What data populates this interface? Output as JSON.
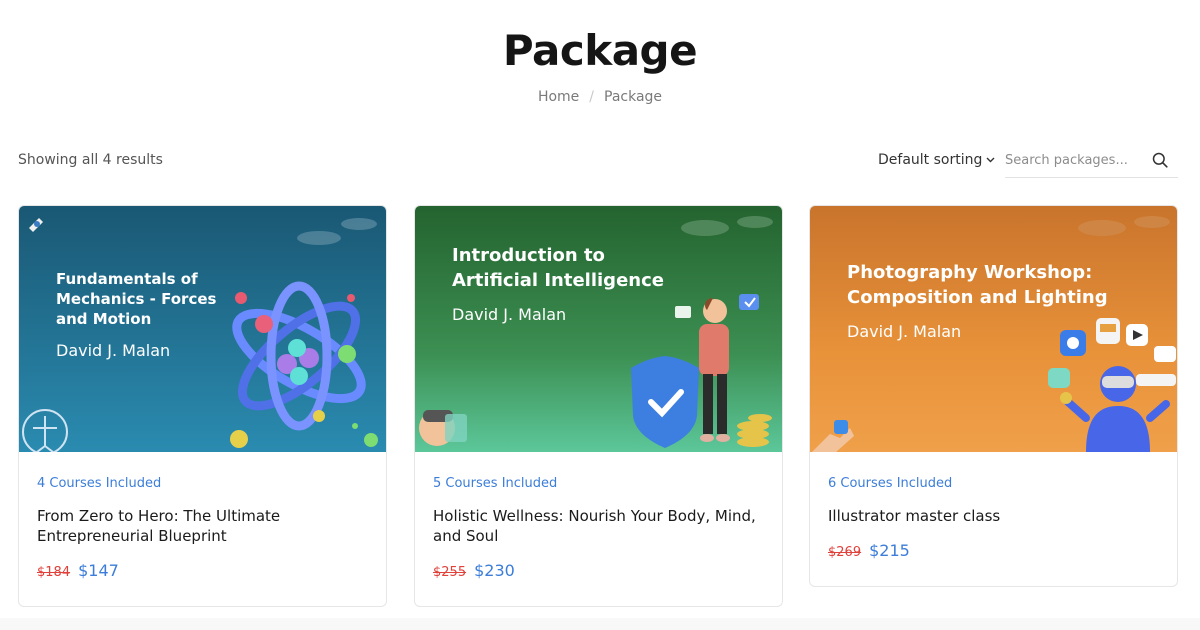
{
  "page": {
    "title": "Package",
    "breadcrumb": {
      "home": "Home",
      "separator": "/",
      "current": "Package"
    }
  },
  "toolbar": {
    "results": "Showing all 4 results",
    "sorting": "Default sorting",
    "search_placeholder": "Search packages..."
  },
  "cards": [
    {
      "image_title_lines": [
        "Fundamentals of",
        "Mechanics - Forces",
        "and Motion"
      ],
      "image_author": "David J. Malan",
      "courses": "4 Courses Included",
      "name": "From Zero to Hero: The Ultimate Entrepreneurial Blueprint",
      "old_price": "$184",
      "price": "$147"
    },
    {
      "image_title_lines": [
        "Introduction to",
        "Artificial Intelligence"
      ],
      "image_author": "David J. Malan",
      "courses": "5 Courses Included",
      "name": "Holistic Wellness: Nourish Your Body, Mind, and Soul",
      "old_price": "$255",
      "price": "$230"
    },
    {
      "image_title_lines": [
        "Photography Workshop:",
        "Composition and Lighting"
      ],
      "image_author": "David J. Malan",
      "courses": "6 Courses Included",
      "name": "Illustrator master class",
      "old_price": "$269",
      "price": "$215"
    }
  ],
  "colors": {
    "accent_blue": "#3b7dd8",
    "old_price_red": "#e0413b",
    "card1_bg": "#1f6d8e",
    "card2_bg": "#2e7d3e",
    "card3_bg": "#e38a2e"
  },
  "icons": {
    "search": "search-icon",
    "sort": "chevron-down-icon"
  }
}
